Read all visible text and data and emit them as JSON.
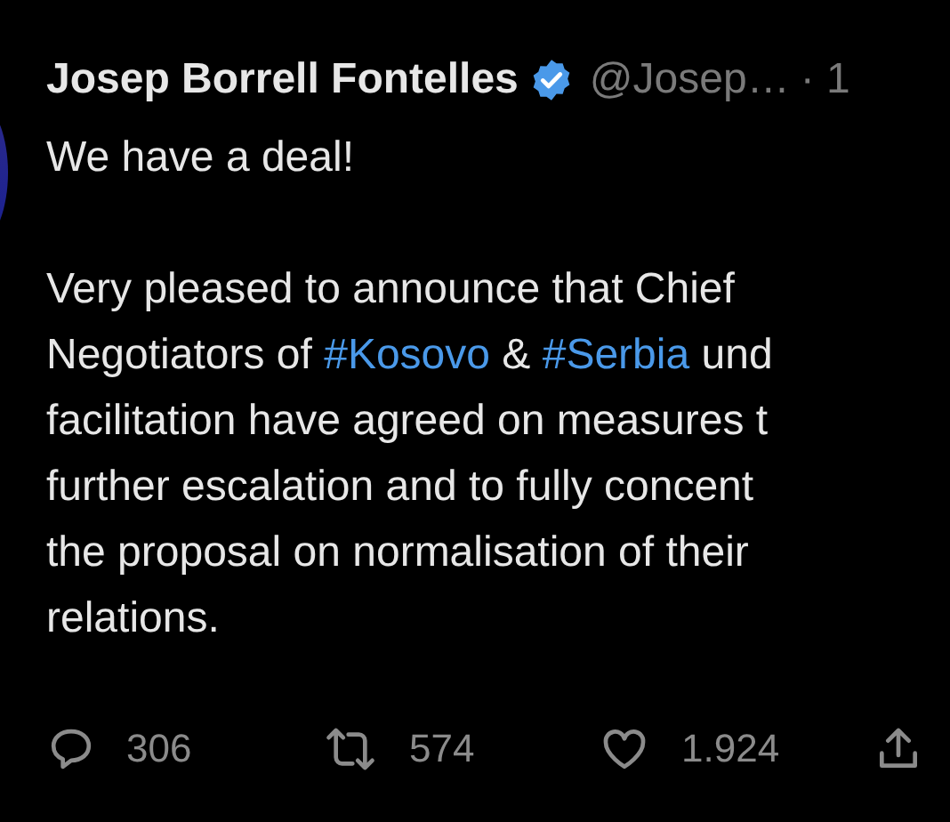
{
  "author": {
    "name": "Josep Borrell Fontelles",
    "verified": true,
    "handle": "@Josep…",
    "time": "· 1"
  },
  "paragraphs": [
    [
      [
        {
          "kind": "text",
          "text": "We have a deal!"
        }
      ]
    ],
    [
      [
        {
          "kind": "text",
          "text": "Very pleased to announce that Chief"
        }
      ],
      [
        {
          "kind": "text",
          "text": "Negotiators of "
        },
        {
          "kind": "hashtag",
          "text": "#Kosovo"
        },
        {
          "kind": "text",
          "text": " & "
        },
        {
          "kind": "hashtag",
          "text": "#Serbia"
        },
        {
          "kind": "text",
          "text": " und"
        }
      ],
      [
        {
          "kind": "text",
          "text": "facilitation have agreed on measures t"
        }
      ],
      [
        {
          "kind": "text",
          "text": "further escalation and to fully concent"
        }
      ],
      [
        {
          "kind": "text",
          "text": "the proposal on normalisation of their"
        }
      ],
      [
        {
          "kind": "text",
          "text": "relations."
        }
      ]
    ]
  ],
  "actions": [
    {
      "kind": "reply",
      "count": "306"
    },
    {
      "kind": "retweet",
      "count": "574"
    },
    {
      "kind": "like",
      "count": "1.924"
    },
    {
      "kind": "share"
    }
  ]
}
